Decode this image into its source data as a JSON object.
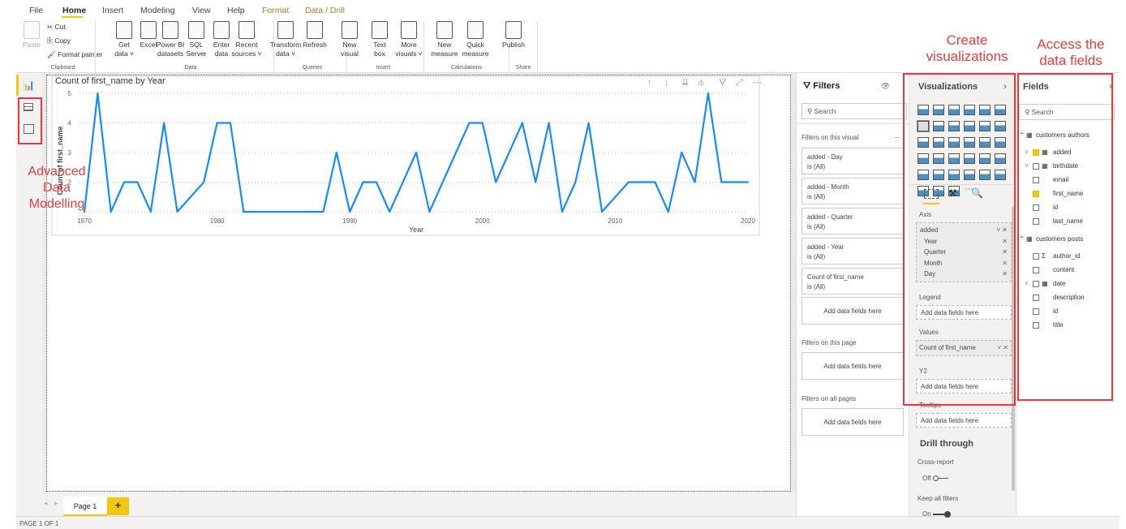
{
  "ribbon": {
    "tabs": [
      "File",
      "Home",
      "Insert",
      "Modeling",
      "View",
      "Help",
      "Format",
      "Data / Drill"
    ],
    "active_tab": "Home",
    "clipboard": {
      "paste": "Paste",
      "cut": "Cut",
      "copy": "Copy",
      "format_painter": "Format painter",
      "group": "Clipboard"
    },
    "data": {
      "buttons": [
        [
          "Get",
          "data ˅"
        ],
        [
          "Excel",
          ""
        ],
        [
          "Power BI",
          "datasets"
        ],
        [
          "SQL",
          "Server"
        ],
        [
          "Enter",
          "data"
        ],
        [
          "Recent",
          "sources ˅"
        ]
      ],
      "group": "Data"
    },
    "queries": {
      "buttons": [
        [
          "Transform",
          "data ˅"
        ],
        [
          "Refresh",
          ""
        ]
      ],
      "group": "Queries"
    },
    "insert": {
      "buttons": [
        [
          "New",
          "visual"
        ],
        [
          "Text",
          "box"
        ],
        [
          "More",
          "visuals ˅"
        ]
      ],
      "group": "Insert"
    },
    "calculations": {
      "buttons": [
        [
          "New",
          "measure"
        ],
        [
          "Quick",
          "measure"
        ]
      ],
      "group": "Calculations"
    },
    "share": {
      "buttons": [
        [
          "Publish",
          ""
        ]
      ],
      "group": "Share"
    }
  },
  "annotations": {
    "create": "Create visualizations",
    "access": "Access the data fields",
    "modelling": "Advanced Data Modelling"
  },
  "sidebar": {
    "items": [
      "report-view-icon",
      "data-view-icon",
      "model-view-icon"
    ]
  },
  "chart_data": {
    "type": "line",
    "title": "Count of first_name by Year",
    "xlabel": "Year",
    "ylabel": "Count of first_name",
    "xlim": [
      1970,
      2020
    ],
    "ylim": [
      1,
      5
    ],
    "x_ticks": [
      1970,
      1980,
      1990,
      2000,
      2010,
      2020
    ],
    "y_ticks": [
      2,
      3,
      4,
      5
    ],
    "grid": true,
    "color": "#118DFF",
    "x": [
      1970,
      1971,
      1972,
      1973,
      1974,
      1975,
      1976,
      1977,
      1979,
      1980,
      1981,
      1982,
      1988,
      1989,
      1990,
      1991,
      1992,
      1993,
      1995,
      1996,
      1999,
      2000,
      2001,
      2003,
      2004,
      2005,
      2006,
      2007,
      2008,
      2009,
      2011,
      2012,
      2013,
      2014,
      2015,
      2016,
      2017,
      2018,
      2020
    ],
    "y": [
      1,
      5,
      1,
      2,
      2,
      1,
      4,
      1,
      2,
      4,
      4,
      1,
      1,
      3,
      1,
      2,
      2,
      1,
      3,
      1,
      4,
      4,
      2,
      4,
      2,
      4,
      1,
      2,
      4,
      1,
      2,
      2,
      2,
      1,
      3,
      2,
      5,
      2,
      2
    ]
  },
  "pages": {
    "tabs": [
      "Page 1"
    ],
    "add": "+",
    "status": "PAGE 1 OF 1"
  },
  "filters": {
    "title": "Filters",
    "search": "Search",
    "on_visual": "Filters on this visual",
    "cards": [
      {
        "name": "added - Day",
        "value": "is (All)"
      },
      {
        "name": "added - Month",
        "value": "is (All)"
      },
      {
        "name": "added - Quarter",
        "value": "is (All)"
      },
      {
        "name": "added - Year",
        "value": "is (All)"
      },
      {
        "name": "Count of first_name",
        "value": "is (All)"
      }
    ],
    "add": "Add data fields here",
    "on_page": "Filters on this page",
    "on_all": "Filters on all pages",
    "more": "..."
  },
  "visualizations": {
    "title": "Visualizations",
    "icons": [
      "stacked-bar",
      "stacked-column",
      "clustered-bar",
      "clustered-column",
      "100-bar",
      "100-column",
      "line",
      "area",
      "stacked-area",
      "line-column",
      "line-clustered",
      "ribbon",
      "waterfall",
      "funnel",
      "scatter",
      "pie",
      "donut",
      "treemap",
      "map",
      "filled-map",
      "gauge",
      "card",
      "multi-row-card",
      "kpi",
      "slicer",
      "table",
      "matrix",
      "r-visual",
      "python-visual",
      "key-influencers",
      "qa",
      "decomposition-tree",
      "smart-narrative",
      "more"
    ],
    "wells": {
      "axis": "Axis",
      "axis_field": "added",
      "axis_items": [
        "Year",
        "Quarter",
        "Month",
        "Day"
      ],
      "legend": "Legend",
      "values": "Values",
      "values_field": "Count of first_name",
      "y2": "Y2",
      "tooltips": "Tooltips",
      "add": "Add data fields here"
    },
    "drill": {
      "title": "Drill through",
      "cross": "Cross-report",
      "off": "Off",
      "keep": "Keep all filters",
      "on": "On"
    }
  },
  "fields": {
    "title": "Fields",
    "search": "Search",
    "tables": [
      {
        "name": "customers authors",
        "fields": [
          {
            "name": "added",
            "checked": true,
            "icon": "calendar"
          },
          {
            "name": "birthdate",
            "checked": false,
            "icon": "calendar"
          },
          {
            "name": "email",
            "checked": false
          },
          {
            "name": "first_name",
            "checked": true
          },
          {
            "name": "id",
            "checked": false
          },
          {
            "name": "last_name",
            "checked": false
          }
        ]
      },
      {
        "name": "customers posts",
        "fields": [
          {
            "name": "author_id",
            "checked": false,
            "icon": "sigma"
          },
          {
            "name": "content",
            "checked": false
          },
          {
            "name": "date",
            "checked": false,
            "icon": "calendar"
          },
          {
            "name": "description",
            "checked": false
          },
          {
            "name": "id",
            "checked": false
          },
          {
            "name": "title",
            "checked": false
          }
        ]
      }
    ]
  }
}
